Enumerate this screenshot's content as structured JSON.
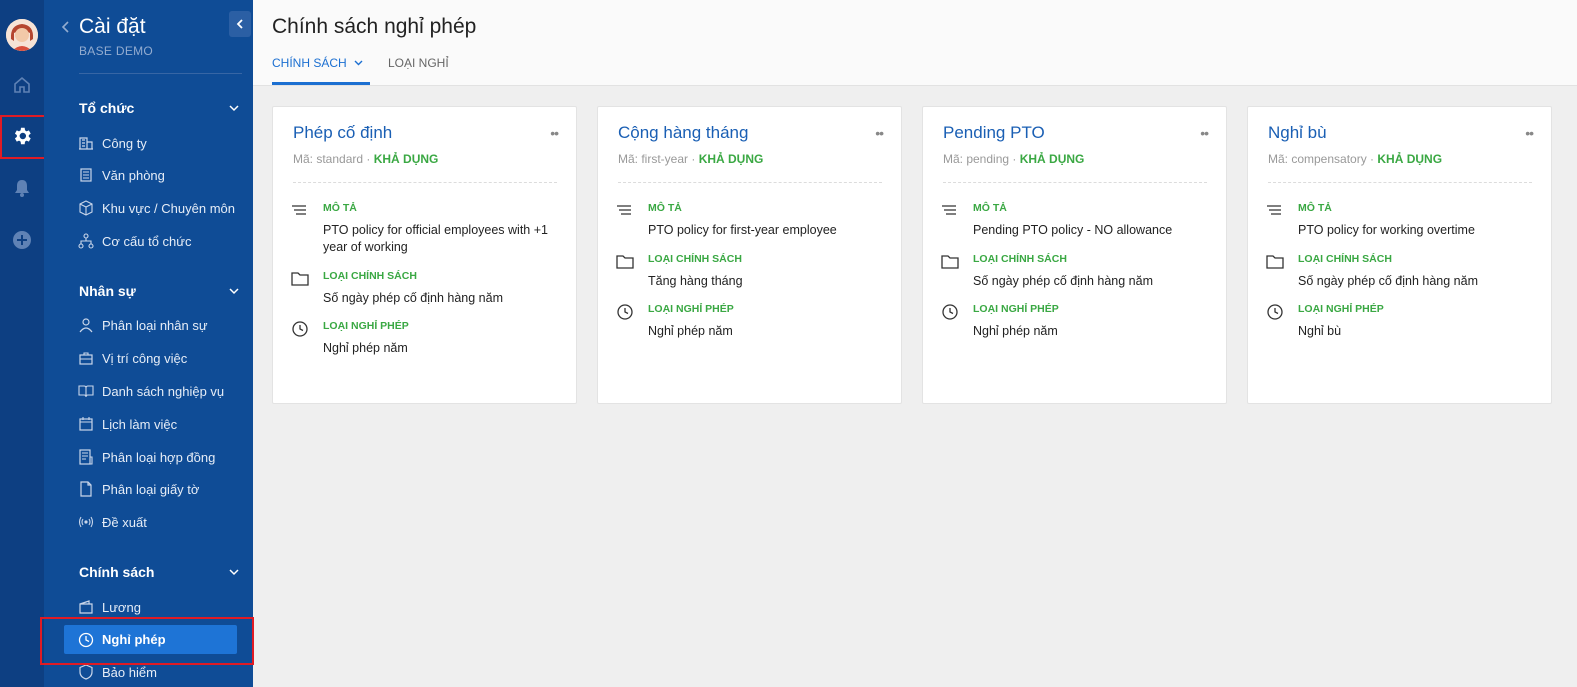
{
  "sidebar": {
    "title": "Cài đặt",
    "subtitle": "BASE DEMO",
    "sections": [
      {
        "label": "Tổ chức",
        "items": [
          "Công ty",
          "Văn phòng",
          "Khu vực / Chuyên môn",
          "Cơ cấu tổ chức"
        ]
      },
      {
        "label": "Nhân sự",
        "items": [
          "Phân loại nhân sự",
          "Vị trí công việc",
          "Danh sách nghiệp vụ",
          "Lịch làm việc",
          "Phân loại hợp đồng",
          "Phân loại giấy tờ",
          "Đề xuất"
        ]
      },
      {
        "label": "Chính sách",
        "items": [
          "Lương",
          "Nghỉ phép",
          "Bảo hiểm"
        ]
      }
    ],
    "active_item": "Nghỉ phép"
  },
  "rail": {
    "icons": [
      "home-icon",
      "gear-icon",
      "bell-icon",
      "plus-circle-icon"
    ],
    "active": "gear-icon"
  },
  "header": {
    "title": "Chính sách nghỉ phép",
    "tabs": [
      {
        "label": "CHÍNH SÁCH",
        "active": true
      },
      {
        "label": "LOẠI NGHỈ",
        "active": false
      }
    ]
  },
  "cards": [
    {
      "title": "Phép cố định",
      "code_label": "Mã: standard",
      "status": "KHẢ DỤNG",
      "desc_label": "MÔ TẢ",
      "desc": "PTO policy for official employees with +1 year of working",
      "policy_label": "LOẠI CHÍNH SÁCH",
      "policy": "Số ngày phép cố định hàng năm",
      "leave_label": "LOẠI NGHỈ PHÉP",
      "leave": "Nghỉ phép năm"
    },
    {
      "title": "Cộng hàng tháng",
      "code_label": "Mã: first-year",
      "status": "KHẢ DỤNG",
      "desc_label": "MÔ TẢ",
      "desc": "PTO policy for first-year employee",
      "policy_label": "LOẠI CHÍNH SÁCH",
      "policy": "Tăng hàng tháng",
      "leave_label": "LOẠI NGHỈ PHÉP",
      "leave": "Nghỉ phép năm"
    },
    {
      "title": "Pending PTO",
      "code_label": "Mã: pending",
      "status": "KHẢ DỤNG",
      "desc_label": "MÔ TẢ",
      "desc": "Pending PTO policy - NO allowance",
      "policy_label": "LOẠI CHÍNH SÁCH",
      "policy": "Số ngày phép cố định hàng năm",
      "leave_label": "LOẠI NGHỈ PHÉP",
      "leave": "Nghỉ phép năm"
    },
    {
      "title": "Nghỉ bù",
      "code_label": "Mã: compensatory",
      "status": "KHẢ DỤNG",
      "desc_label": "MÔ TẢ",
      "desc": "PTO policy for working overtime",
      "policy_label": "LOẠI CHÍNH SÁCH",
      "policy": "Số ngày phép cố định hàng năm",
      "leave_label": "LOẠI NGHỈ PHÉP",
      "leave": "Nghỉ bù"
    }
  ],
  "colors": {
    "sidebar": "#0f4c96",
    "rail": "#0d3f82",
    "accent": "#1b6fd1",
    "status_green": "#3aa843",
    "highlight": "#e01b24"
  }
}
